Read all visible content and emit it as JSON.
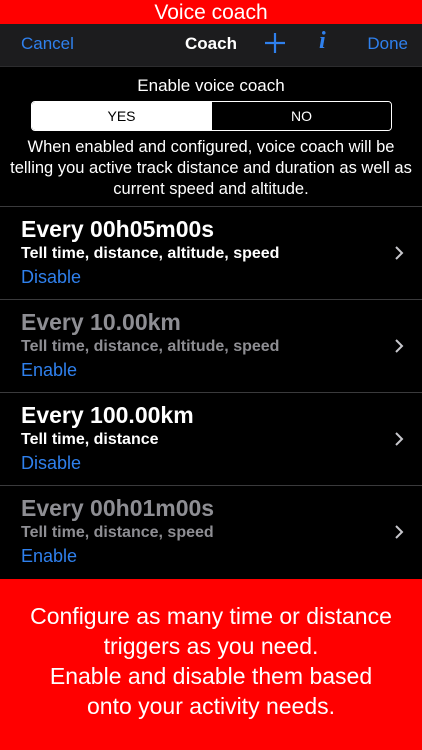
{
  "banner_top": "Voice coach",
  "nav": {
    "cancel": "Cancel",
    "title": "Coach",
    "done": "Done",
    "add_icon": "plus-icon",
    "info_icon": "info-icon",
    "info_glyph": "i"
  },
  "enable": {
    "label": "Enable voice coach",
    "yes": "YES",
    "no": "NO",
    "selected": "YES",
    "description": "When enabled and configured, voice coach will be telling you active track distance and duration as well as current speed and altitude."
  },
  "triggers": [
    {
      "title": "Every 00h05m00s",
      "subtitle": "Tell time, distance, altitude, speed",
      "action": "Disable",
      "enabled": true
    },
    {
      "title": "Every 10.00km",
      "subtitle": "Tell time, distance, altitude, speed",
      "action": "Enable",
      "enabled": false
    },
    {
      "title": "Every 100.00km",
      "subtitle": "Tell time, distance",
      "action": "Disable",
      "enabled": true
    },
    {
      "title": "Every 00h01m00s",
      "subtitle": "Tell time, distance, speed",
      "action": "Enable",
      "enabled": false
    }
  ],
  "banner_bottom": {
    "line1": "Configure as many time or distance",
    "line2": "triggers as you need.",
    "line3": "Enable and disable them based",
    "line4": "onto your activity needs."
  },
  "colors": {
    "accent": "#2f80ed",
    "banner": "#ff0000",
    "background": "#000000",
    "dim_text": "#8e8e93"
  }
}
